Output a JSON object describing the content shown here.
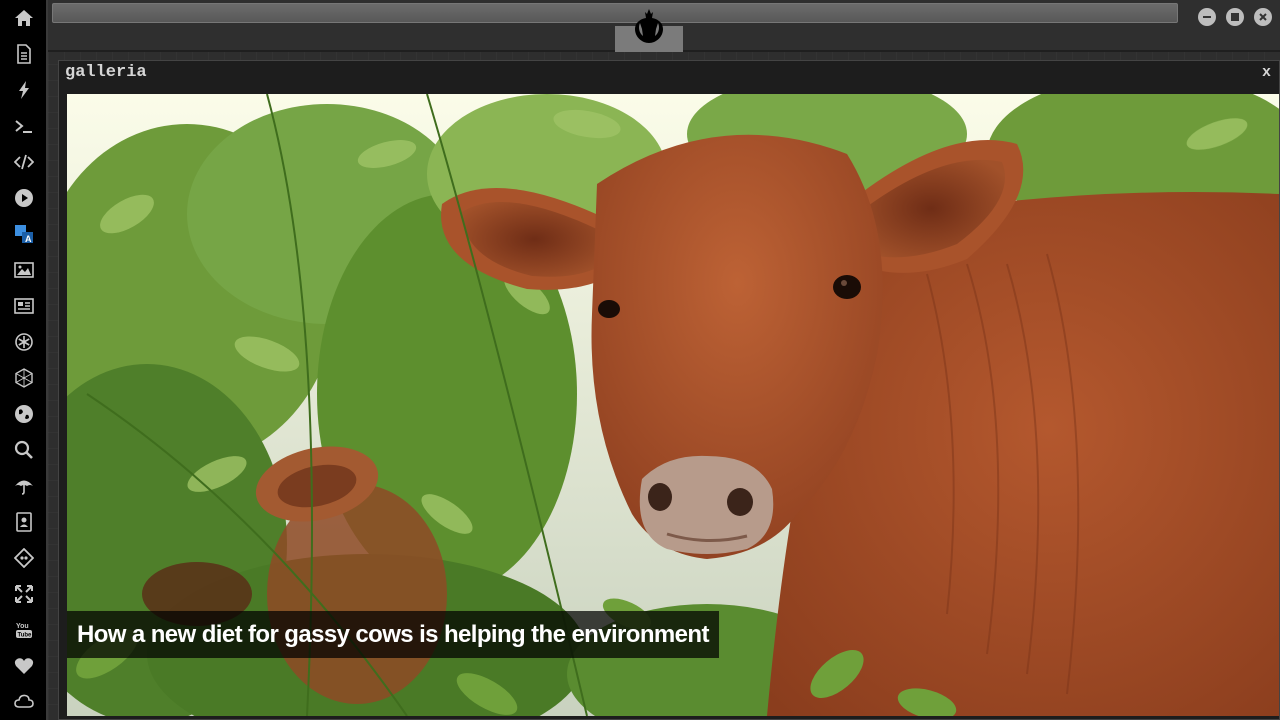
{
  "window": {
    "title": "galleria",
    "close_label": "x"
  },
  "gallery": {
    "caption": "How a new diet for gassy cows is helping the environment"
  },
  "sidebar": {
    "icons": [
      "home-icon",
      "document-icon",
      "bolt-icon",
      "terminal-icon",
      "code-icon",
      "play-icon",
      "translate-icon",
      "image-icon",
      "news-icon",
      "settings-icon",
      "hex-network-icon",
      "globe-icon",
      "search-icon",
      "umbrella-icon",
      "contacts-icon",
      "git-icon",
      "fullscreen-icon",
      "youtube-icon",
      "heart-icon",
      "cloud-icon"
    ]
  },
  "colors": {
    "sidebar_bg": "#000000",
    "active_icon": "#3d8fe0",
    "icon": "#c8c8c8"
  }
}
